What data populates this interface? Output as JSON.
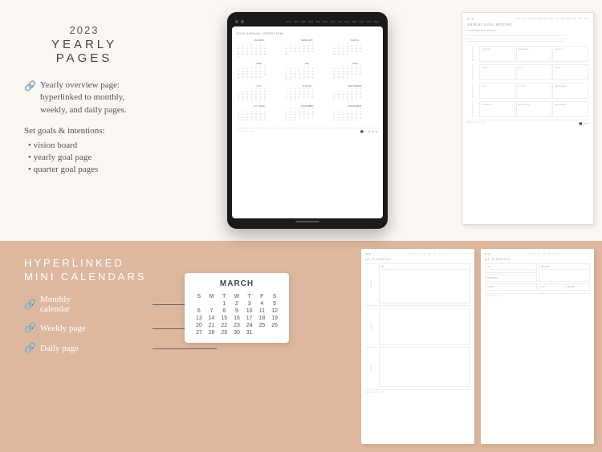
{
  "top_left": {
    "year": "2023",
    "title": "YEARLY PAGES",
    "feature1_icon": "🔗",
    "feature1_text": "Yearly overview page: hyperlinked to monthly, weekly, and daily pages.",
    "goals_title": "Set goals & intentions:",
    "bullets": [
      "vision board",
      "yearly goal page",
      "quarter goal pages"
    ]
  },
  "top_center": {
    "ipad_screen_title": "2023 ANNUAL OVERVIEW",
    "months": [
      "JANUARY",
      "FEBRUARY",
      "MARCH",
      "APRIL",
      "MAY",
      "JUNE",
      "JULY",
      "AUGUST",
      "SEPTEMBER",
      "OCTOBER",
      "NOVEMBER",
      "DECEMBER"
    ]
  },
  "top_right": {
    "title": "ANNUAL GOAL SETTING",
    "subtitle": "TOP PRIORITIES FOR 2023",
    "quarters": [
      "QUARTER 1",
      "QUARTER 2",
      "QUARTER 3",
      "QUARTER 4"
    ],
    "months_q1": [
      "JANUARY",
      "FEBRUARY",
      "MARCH"
    ],
    "months_q2": [
      "APRIL",
      "MAY",
      "JUNE"
    ],
    "months_q3": [
      "JULY",
      "AUGUST",
      "SEPTEMBER"
    ],
    "months_q4": [
      "OCTOBER",
      "NOVEMBER",
      "DECEMBER"
    ]
  },
  "bottom_left": {
    "title_line1": "HYPERLINKED",
    "title_line2": "MINI CALENDARS",
    "features": [
      {
        "icon": "🔗",
        "label": "Monthly calendar"
      },
      {
        "icon": "🔗",
        "label": "Weekly page"
      },
      {
        "icon": "🔗",
        "label": "Daily page"
      }
    ]
  },
  "mini_calendar": {
    "month": "MARCH",
    "days_header": [
      "S",
      "M",
      "T",
      "W",
      "T",
      "F",
      "S"
    ],
    "rows": [
      [
        "",
        "",
        "1",
        "2",
        "3",
        "4",
        "5"
      ],
      [
        "6",
        "7",
        "8",
        "9",
        "10",
        "11",
        "12"
      ],
      [
        "13",
        "14",
        "15",
        "16",
        "17",
        "18",
        "19"
      ],
      [
        "20",
        "21",
        "22",
        "23",
        "24",
        "25",
        "26"
      ],
      [
        "27",
        "28",
        "29",
        "30",
        "31",
        "",
        ""
      ]
    ],
    "faded_prev": [],
    "faded_next": []
  },
  "bottom_right": {
    "page1_title": "Q1 PLANNING",
    "page2_title": "Q1 PLANNING",
    "quarters": [
      "Q1"
    ],
    "months": [
      "JANUARY",
      "FEBRUARY",
      "MARCH"
    ],
    "sections": [
      "LIST",
      "NOTES"
    ]
  }
}
